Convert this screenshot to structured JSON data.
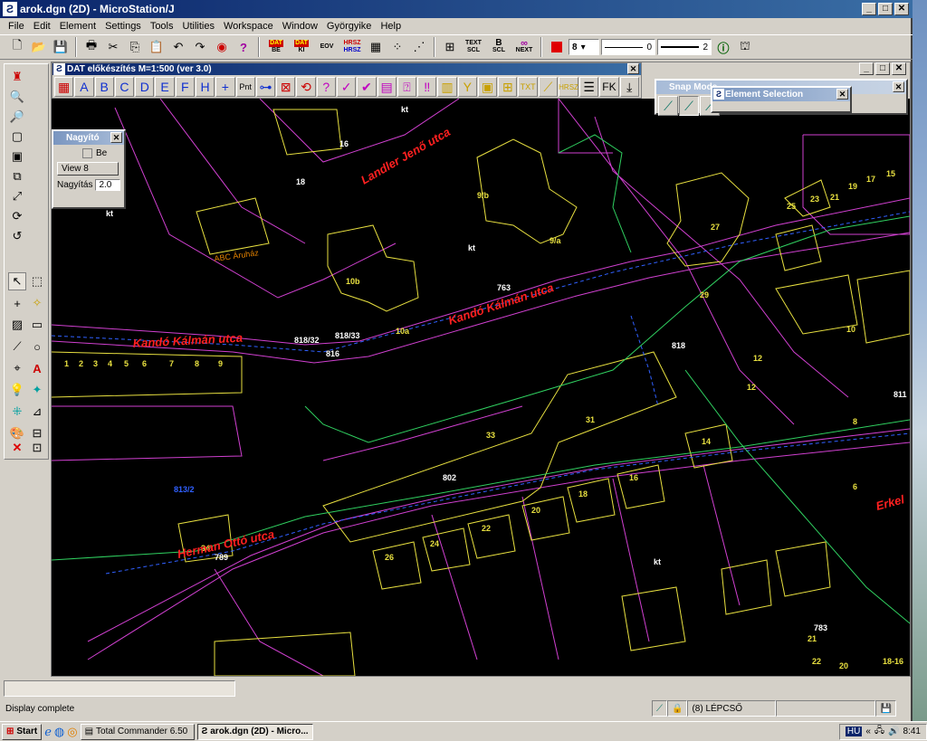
{
  "window": {
    "title": "arok.dgn (2D) - MicroStation/J"
  },
  "menu": [
    "File",
    "Edit",
    "Element",
    "Settings",
    "Tools",
    "Utilities",
    "Workspace",
    "Window",
    "Györgyike",
    "Help"
  ],
  "toolbar": {
    "dat_be": [
      "DAT",
      "BE"
    ],
    "dat_ki": [
      "DAT",
      "KI"
    ],
    "eov": "EOV",
    "hrsz": [
      "HRSZ",
      "HRSZ"
    ],
    "text_scl": [
      "TEXT",
      "SCL"
    ],
    "b_scl": [
      "B",
      "SCL"
    ],
    "next": "NEXT",
    "level": "8",
    "style": "0",
    "weight": "2"
  },
  "dat_panel": {
    "title": "DAT előkészítés M=1:500  (ver 3.0)",
    "letters": [
      "A",
      "B",
      "C",
      "D",
      "E",
      "F",
      "H"
    ],
    "pnt": "Pnt",
    "fk": "FK"
  },
  "nagyito": {
    "title": "Nagyító",
    "be_label": "Be",
    "view": "View 8",
    "nagyitas_label": "Nagyítás",
    "nagyitas_value": "2.0"
  },
  "snap": {
    "title": "Snap Mode"
  },
  "elemsel": {
    "title": "Element Selection"
  },
  "status": {
    "message": "Display complete",
    "level_info": "(8) LÉPCSŐ"
  },
  "taskbar": {
    "start": "Start",
    "tc": "Total Commander 6.50 - ...",
    "ms": "arok.dgn (2D) - Micro...",
    "lang": "HU",
    "time": "8:41"
  },
  "map_labels": {
    "streets": [
      "Landler Jenő utca",
      "Kandó Kálmán utca",
      "Kandó Kálmán utca",
      "Herman Ottó utca",
      "Erkel"
    ],
    "shop": "ABC Áruház",
    "house_numbers": [
      "16",
      "18",
      "9/b",
      "9/a",
      "10b",
      "10a",
      "27",
      "29",
      "25",
      "23",
      "21",
      "19",
      "17",
      "15",
      "10",
      "12",
      "12",
      "14",
      "16",
      "20",
      "18",
      "22",
      "24",
      "26",
      "33",
      "31",
      "34",
      "8",
      "6",
      "21",
      "25",
      "22",
      "20",
      "18-16",
      "1",
      "2",
      "3",
      "4",
      "5",
      "6",
      "7",
      "8",
      "9"
    ],
    "parcel_numbers": [
      "813/2",
      "818/32",
      "818/33",
      "816",
      "763",
      "802",
      "789",
      "783",
      "811",
      "818"
    ],
    "ki": [
      "kt",
      "kt",
      "kt",
      "kt"
    ]
  }
}
